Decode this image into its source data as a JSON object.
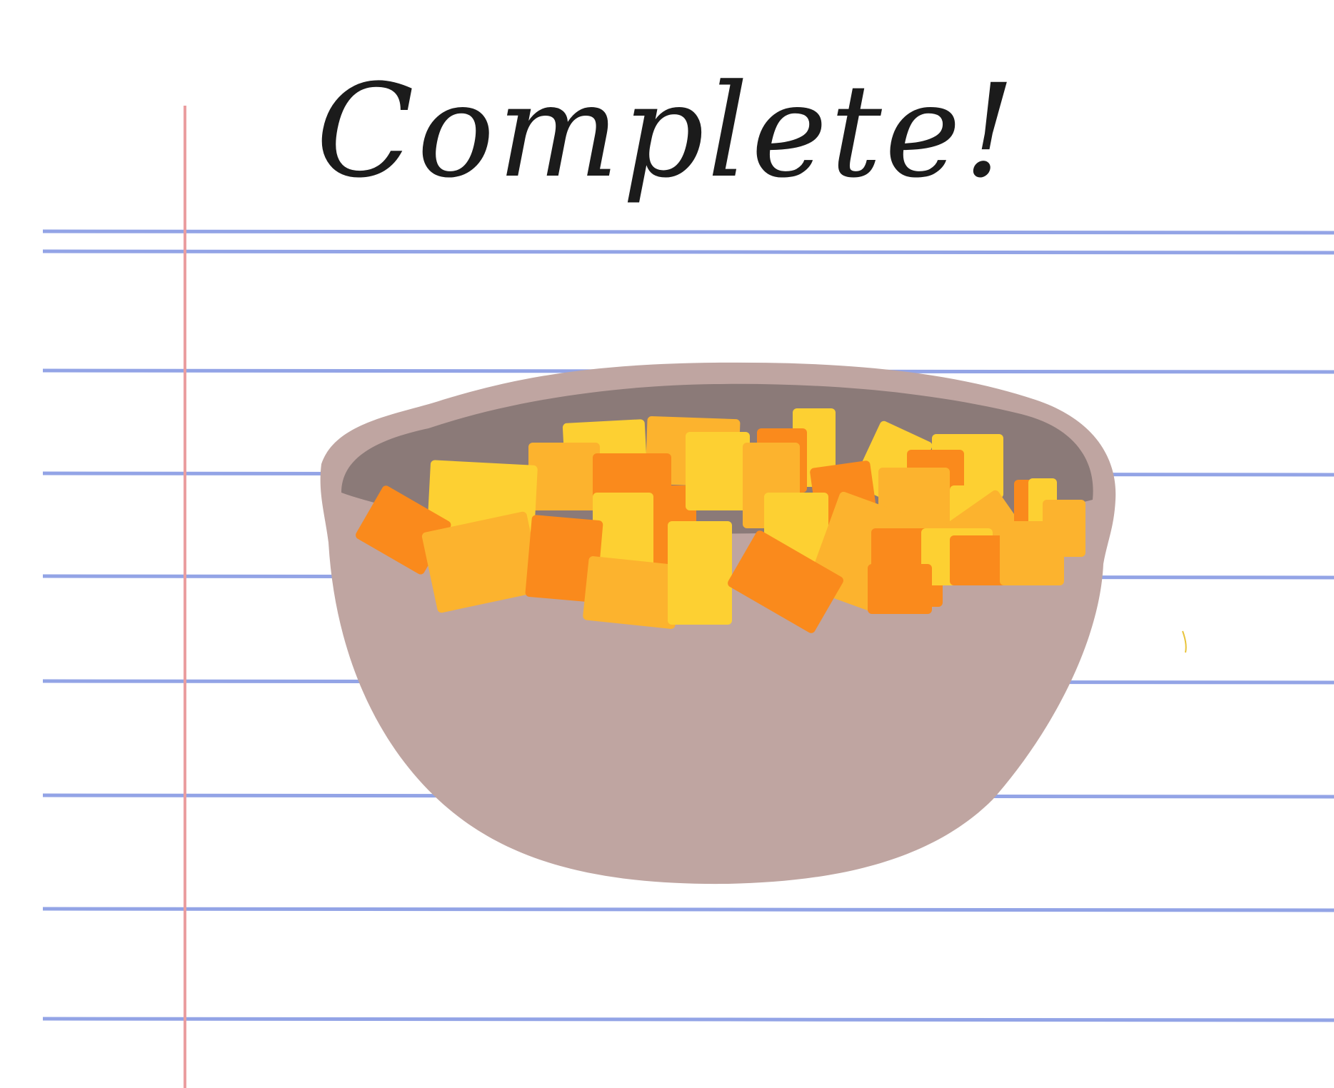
{
  "headline": "Complete!",
  "colors": {
    "paper": "#ffffff",
    "rule_line": "#93a4e6",
    "margin_line": "#ea9ea0",
    "bowl_outer": "#bfa5a1",
    "bowl_inner": "#8b7a78",
    "ink": "#1b1b1b",
    "cube_yellow": "#fdd032",
    "cube_amber": "#fcb32e",
    "cube_orange": "#fa8a1c"
  },
  "icons": {
    "bowl": "bowl-icon",
    "food": "diced-squash-cubes"
  }
}
